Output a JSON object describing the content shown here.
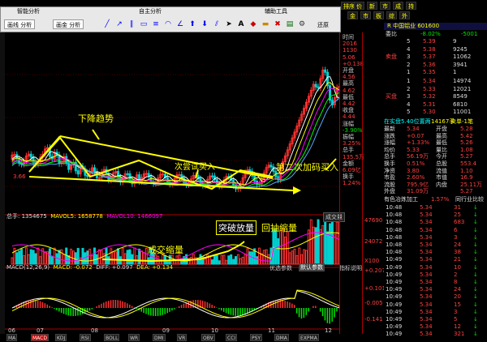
{
  "toolbar": {
    "nav": [
      "排序",
      "价",
      "新",
      "市",
      "成",
      "持",
      "金",
      "市",
      "板",
      "综",
      "外"
    ],
    "window_tabs": [
      "智能分析",
      "自主分析",
      "辅助工具"
    ],
    "buttons": [
      "画线 分析",
      "画金 分析"
    ],
    "restore": "还原",
    "layout": "版面"
  },
  "main_chart": {
    "price_ticks": [
      "5.34",
      "4.61",
      "4.10",
      "3.84",
      "3.66"
    ],
    "low_label": "3.66",
    "annotations": {
      "downtrend": "下降趋势",
      "second_try": "次尝试买入",
      "second_add": "第二次加码买入",
      "breakout_vol": "突破放量",
      "pullback_shrink": "回抽缩量",
      "vol_shrink": "成交缩量"
    }
  },
  "volume_panel": {
    "header": [
      "总手: 1354675",
      "MAVOL5: 1658778",
      "MAVOL10: 1466097"
    ],
    "dropdown": "成交量",
    "ticks": [
      "47690",
      "24072",
      "X100"
    ],
    "tabs": [
      "优选参数",
      "默认参数",
      "指标说明"
    ]
  },
  "macd_panel": {
    "header": [
      "MACD(12,26,9)",
      "MACD: -0.072",
      "DIFF: +0.097",
      "DEA: +0.134"
    ],
    "ticks": [
      "+0.207",
      "+0.101",
      "-0.005",
      "-0.141"
    ]
  },
  "x_axis": [
    "06",
    "07",
    "08",
    "09",
    "10",
    "11",
    "12"
  ],
  "mid_info": {
    "rows": [
      {
        "label": "时间",
        "value": ""
      },
      {
        "label": "",
        "value": "2016"
      },
      {
        "label": "",
        "value": "1130"
      },
      {
        "label": "",
        "value": "5.06"
      },
      {
        "label": "",
        "value": "+0.138"
      },
      {
        "label": "开盘",
        "value": ""
      },
      {
        "label": "",
        "value": "4.56"
      },
      {
        "label": "最高",
        "value": ""
      },
      {
        "label": "",
        "value": "4.62"
      },
      {
        "label": "最低",
        "value": ""
      },
      {
        "label": "",
        "value": "4.42"
      },
      {
        "label": "收盘",
        "value": ""
      },
      {
        "label": "",
        "value": "4.44"
      },
      {
        "label": "涨幅",
        "value": ""
      },
      {
        "label": "",
        "value": "-3.90%"
      },
      {
        "label": "振幅",
        "value": ""
      },
      {
        "label": "",
        "value": "3.25%"
      },
      {
        "label": "总手",
        "value": ""
      },
      {
        "label": "",
        "value": "135.5万"
      },
      {
        "label": "金额",
        "value": ""
      },
      {
        "label": "",
        "value": "6.09亿"
      },
      {
        "label": "换手",
        "value": ""
      },
      {
        "label": "",
        "value": "1.24%"
      }
    ]
  },
  "right_panel": {
    "stock_title": "R 中国铝业 601600",
    "ratio": {
      "label": "委比",
      "value": "-8.02%",
      "diff": "-5001"
    },
    "sell": [
      {
        "lvl": "5",
        "price": "5.39",
        "vol": "9"
      },
      {
        "lvl": "4",
        "price": "5.38",
        "vol": "9245"
      },
      {
        "lvl": "3",
        "price": "5.37",
        "vol": "11062"
      },
      {
        "lvl": "2",
        "price": "5.36",
        "vol": "3941"
      },
      {
        "lvl": "1",
        "price": "5.35",
        "vol": "1"
      }
    ],
    "buy": [
      {
        "lvl": "1",
        "price": "5.34",
        "vol": "14974"
      },
      {
        "lvl": "2",
        "price": "5.33",
        "vol": "12021"
      },
      {
        "lvl": "3",
        "price": "5.32",
        "vol": "8549"
      },
      {
        "lvl": "4",
        "price": "5.31",
        "vol": "6810"
      },
      {
        "lvl": "5",
        "price": "5.30",
        "vol": "11001"
      }
    ],
    "side_labels": {
      "sell": "卖盘",
      "buy": "买盘"
    },
    "notice": "在实盘5.40位置两",
    "notice2": "14167手",
    "notice3": "卖单-1笔",
    "stats_left": [
      [
        "最新",
        "5.34"
      ],
      [
        "涨跌",
        "+0.07"
      ],
      [
        "涨幅",
        "+1.33%"
      ],
      [
        "均价",
        "5.33"
      ],
      [
        "总手",
        "56.19万"
      ],
      [
        "换手",
        "0.51%"
      ],
      [
        "净资",
        "3.80"
      ],
      [
        "市盈",
        "2.60%"
      ],
      [
        "流股",
        "795.9亿"
      ],
      [
        "外盘",
        "31.09万"
      ]
    ],
    "stats_right": [
      [
        "开盘",
        "5.28"
      ],
      [
        "最高",
        "5.42"
      ],
      [
        "最低",
        "5.26"
      ],
      [
        "量比",
        "1.08"
      ],
      [
        "今开",
        "5.27"
      ],
      [
        "总股",
        "553.4"
      ],
      [
        "流值",
        "1.10"
      ],
      [
        "市值",
        "16.9"
      ],
      [
        "内盘",
        "25.11万"
      ],
      [
        "",
        "5.27"
      ]
    ],
    "trades_header": [
      "有色冶炼加工",
      "1.57%",
      "同行业比较"
    ],
    "trades": [
      {
        "t": "10:48",
        "p": "5.34",
        "v": "31"
      },
      {
        "t": "10:48",
        "p": "5.34",
        "v": "25"
      },
      {
        "t": "10:48",
        "p": "5.34",
        "v": "683"
      },
      {
        "t": "10:48",
        "p": "5.34",
        "v": "6"
      },
      {
        "t": "10:48",
        "p": "5.34",
        "v": "3"
      },
      {
        "t": "10:48",
        "p": "5.34",
        "v": "24"
      },
      {
        "t": "10:48",
        "p": "5.34",
        "v": "38"
      },
      {
        "t": "10:49",
        "p": "5.34",
        "v": "21"
      },
      {
        "t": "10:49",
        "p": "5.34",
        "v": "10"
      },
      {
        "t": "10:49",
        "p": "5.34",
        "v": "2"
      },
      {
        "t": "10:49",
        "p": "5.34",
        "v": "8"
      },
      {
        "t": "10:49",
        "p": "5.34",
        "v": "24"
      },
      {
        "t": "10:49",
        "p": "5.34",
        "v": "20"
      },
      {
        "t": "10:49",
        "p": "5.34",
        "v": "15"
      },
      {
        "t": "10:49",
        "p": "5.34",
        "v": "3"
      },
      {
        "t": "10:49",
        "p": "5.34",
        "v": "5"
      },
      {
        "t": "10:49",
        "p": "5.34",
        "v": "12"
      },
      {
        "t": "10:49",
        "p": "5.34",
        "v": "321"
      }
    ]
  },
  "bottom_tabs": [
    "MA",
    "MACD",
    "KDJ",
    "RSI",
    "BOLL",
    "WR",
    "DMI",
    "VR",
    "OBV",
    "CCI",
    "PSY",
    "DMA",
    "EXPMA"
  ]
}
